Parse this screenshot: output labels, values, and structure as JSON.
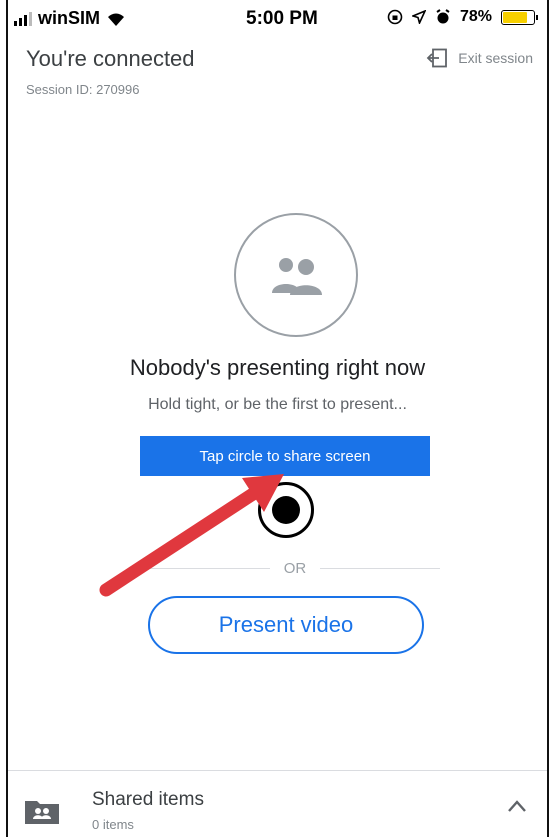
{
  "status_bar": {
    "carrier": "winSIM",
    "time": "5:00 PM",
    "battery_percent": "78%",
    "battery_level": 0.78,
    "battery_color": "#f7d000"
  },
  "header": {
    "title": "You're connected",
    "session_id": "Session ID: 270996",
    "exit_label": "Exit session",
    "exit_icon": "exit-icon"
  },
  "main": {
    "avatar_icon": "people-icon",
    "headline": "Nobody's presenting right now",
    "subline": "Hold tight, or be the first to present...",
    "share_button_label": "Tap circle to share screen",
    "or_label": "OR",
    "present_video_label": "Present video"
  },
  "footer": {
    "shared_title": "Shared items",
    "shared_count": "0 items",
    "folder_icon": "shared-folder-icon",
    "chevron_icon": "chevron-up-icon"
  },
  "colors": {
    "accent": "#1a73e8",
    "annotation_arrow": "#e0383e"
  }
}
